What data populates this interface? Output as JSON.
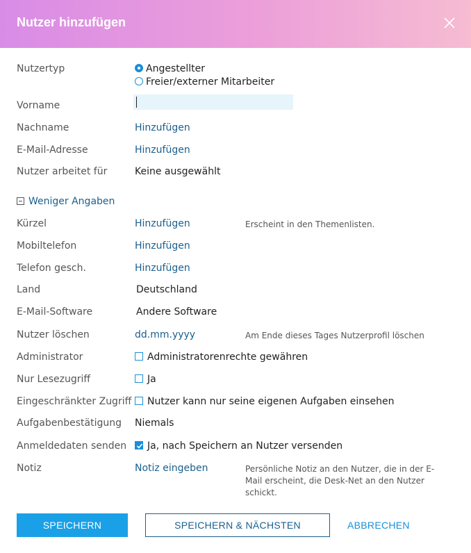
{
  "header": {
    "title": "Nutzer hinzufügen"
  },
  "colors": {
    "accent": "#1aa0e6",
    "link": "#1a5f8e",
    "header_gradient_start": "#d98ce6",
    "header_gradient_end": "#f6bcd2"
  },
  "form": {
    "user_type": {
      "label": "Nutzertyp",
      "options": [
        "Angestellter",
        "Freier/externer Mitarbeiter"
      ],
      "selected": "Angestellter"
    },
    "first_name": {
      "label": "Vorname",
      "value": ""
    },
    "last_name": {
      "label": "Nachname",
      "value": "Hinzufügen"
    },
    "email": {
      "label": "E-Mail-Adresse",
      "value": "Hinzufügen"
    },
    "works_for": {
      "label": "Nutzer arbeitet für",
      "value": "Keine ausgewählt"
    },
    "less_details": "Weniger Angaben",
    "abbreviation": {
      "label": "Kürzel",
      "value": "Hinzufügen",
      "hint": "Erscheint in den Themenlisten."
    },
    "mobile": {
      "label": "Mobiltelefon",
      "value": "Hinzufügen"
    },
    "phone_business": {
      "label": "Telefon gesch.",
      "value": "Hinzufügen"
    },
    "country": {
      "label": "Land",
      "value": "Deutschland"
    },
    "email_software": {
      "label": "E-Mail-Software",
      "value": "Andere Software"
    },
    "delete_user": {
      "label": "Nutzer löschen",
      "value": "dd.mm.yyyy",
      "hint": "Am Ende dieses Tages Nutzerprofil löschen"
    },
    "administrator": {
      "label": "Administrator",
      "checkbox_label": "Administratorenrechte gewähren",
      "checked": false
    },
    "read_only": {
      "label": "Nur Lesezugriff",
      "checkbox_label": "Ja",
      "checked": false
    },
    "restricted": {
      "label": "Eingeschränkter Zugriff",
      "checkbox_label": "Nutzer kann nur seine eigenen Aufgaben einsehen",
      "checked": false
    },
    "task_confirmation": {
      "label": "Aufgabenbestätigung",
      "value": "Niemals"
    },
    "send_credentials": {
      "label": "Anmeldedaten senden",
      "checkbox_label": "Ja, nach Speichern an Nutzer versenden",
      "checked": true
    },
    "note": {
      "label": "Notiz",
      "value": "Notiz eingeben",
      "hint_lines": [
        "Persönliche Notiz an den Nutzer, die in der E-",
        "Mail erscheint, die Desk-Net an den Nutzer",
        "schickt."
      ]
    }
  },
  "buttons": {
    "save": "SPEICHERN",
    "save_next": "SPEICHERN & NÄCHSTEN",
    "cancel": "ABBRECHEN"
  }
}
